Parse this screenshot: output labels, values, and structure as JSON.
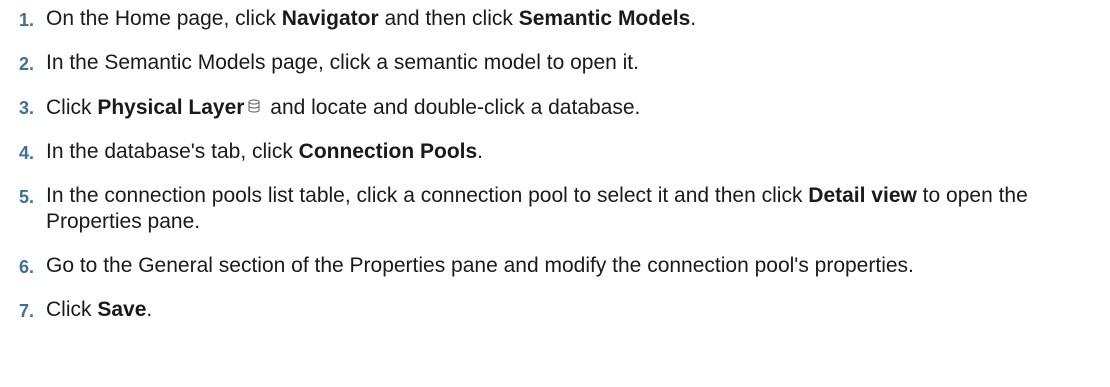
{
  "steps": [
    {
      "number": "1.",
      "parts": [
        "On the Home page, click ",
        "Navigator",
        " and then click ",
        "Semantic Models",
        "."
      ]
    },
    {
      "number": "2.",
      "parts": [
        "In the Semantic Models page, click a semantic model to open it."
      ]
    },
    {
      "number": "3.",
      "parts": [
        "Click ",
        "Physical Layer",
        " and locate and double-click a database."
      ],
      "icon": "database-icon"
    },
    {
      "number": "4.",
      "parts": [
        "In the database's tab, click ",
        "Connection Pools",
        "."
      ]
    },
    {
      "number": "5.",
      "parts": [
        "In the connection pools list table, click a connection pool to select it and then click ",
        "Detail view",
        " to open the Properties pane."
      ]
    },
    {
      "number": "6.",
      "parts": [
        "Go to the General section of the Properties pane and modify the connection pool's properties."
      ]
    },
    {
      "number": "7.",
      "parts": [
        "Click ",
        "Save",
        "."
      ]
    }
  ]
}
